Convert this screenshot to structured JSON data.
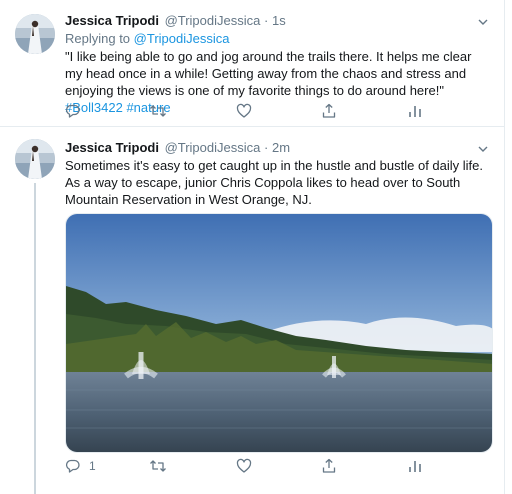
{
  "tweets": [
    {
      "author_name": "Jessica Tripodi",
      "author_handle": "@TripodiJessica",
      "separator": "·",
      "time": "1s",
      "replying_label": "Replying to",
      "replying_to": "@TripodiJessica",
      "text": "\"I like being able to go and jog around the trails there. It helps me clear my head once in a while! Getting away from the chaos and stress and enjoying the views is one of my favorite things to do around here!\"",
      "hashtags": [
        "#Boll3422",
        "#nature"
      ],
      "reply_count": ""
    },
    {
      "author_name": "Jessica Tripodi",
      "author_handle": "@TripodiJessica",
      "separator": "·",
      "time": "2m",
      "text": "Sometimes it's easy to get caught up in the hustle and bustle of daily life. As a way to escape, junior Chris Coppola likes to head over to South Mountain Reservation in West Orange, NJ.",
      "reply_count": "1"
    }
  ],
  "icons": {
    "reply": "reply-icon",
    "retweet": "retweet-icon",
    "like": "like-icon",
    "share": "share-icon",
    "analytics": "analytics-icon",
    "caret": "chevron-down-icon"
  },
  "colors": {
    "link": "#1b95e0",
    "secondary_text": "#657786",
    "divider": "#e6ecf0"
  }
}
